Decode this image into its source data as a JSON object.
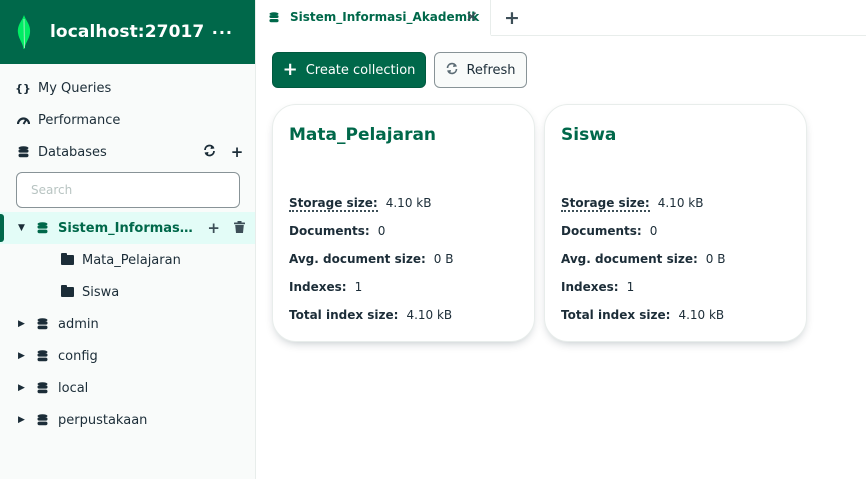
{
  "sidebar": {
    "connection_title": "localhost:27017",
    "more_label": "···",
    "nav": [
      {
        "icon": "{}",
        "label": "My Queries"
      },
      {
        "icon": "gauge",
        "label": "Performance"
      },
      {
        "icon": "database",
        "label": "Databases"
      }
    ],
    "search_placeholder": "Search",
    "databases": [
      {
        "name": "Sistem_Informasi_Akademik",
        "expanded": true,
        "active": true,
        "collections": [
          "Mata_Pelajaran",
          "Siswa"
        ]
      },
      {
        "name": "admin",
        "expanded": false
      },
      {
        "name": "config",
        "expanded": false
      },
      {
        "name": "local",
        "expanded": false
      },
      {
        "name": "perpustakaan",
        "expanded": false
      }
    ]
  },
  "tabs": [
    {
      "label": "Sistem_Informasi_Akademik",
      "close": "✕"
    }
  ],
  "tab_add": "+",
  "toolbar": {
    "create_label": "Create collection",
    "refresh_label": "Refresh"
  },
  "stat_labels": {
    "storage": "Storage size:",
    "documents": "Documents:",
    "avg": "Avg. document size:",
    "indexes": "Indexes:",
    "total_index": "Total index size:"
  },
  "collections": [
    {
      "name": "Mata_Pelajaran",
      "storage_size": "4.10 kB",
      "documents": "0",
      "avg_document_size": "0 B",
      "indexes": "1",
      "total_index_size": "4.10 kB"
    },
    {
      "name": "Siswa",
      "storage_size": "4.10 kB",
      "documents": "0",
      "avg_document_size": "0 B",
      "indexes": "1",
      "total_index_size": "4.10 kB"
    }
  ],
  "colors": {
    "brand": "#00684a",
    "active_bg": "#e3fcf7"
  }
}
